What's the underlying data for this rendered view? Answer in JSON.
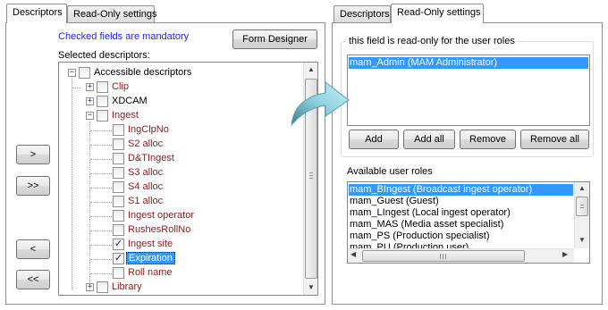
{
  "left": {
    "tabs": [
      "Descriptors",
      "Read-Only settings"
    ],
    "mandatory_note": "Checked fields are mandatory",
    "form_designer_label": "Form Designer",
    "selected_label": "Selected descriptors:",
    "move_buttons": [
      ">",
      ">>",
      "<",
      "<<"
    ],
    "tree": {
      "root": "Accessible descriptors",
      "items": [
        {
          "label": "Clip",
          "checked": false,
          "expander": "+"
        },
        {
          "label": "XDCAM",
          "checked": false,
          "expander": "+"
        },
        {
          "label": "Ingest",
          "checked": false,
          "expander": "-"
        },
        {
          "label": "IngClpNo",
          "checked": false
        },
        {
          "label": "S2 alloc",
          "checked": false
        },
        {
          "label": "D&TIngest",
          "checked": false
        },
        {
          "label": "S3 alloc",
          "checked": false
        },
        {
          "label": "S4 alloc",
          "checked": false
        },
        {
          "label": "S1 alloc",
          "checked": false
        },
        {
          "label": "Ingest operator",
          "checked": false
        },
        {
          "label": "RushesRollNo",
          "checked": false
        },
        {
          "label": "Ingest site",
          "checked": true
        },
        {
          "label": "Expiration",
          "checked": true,
          "selected": true
        },
        {
          "label": "Roll name",
          "checked": false
        },
        {
          "label": "Library",
          "checked": false,
          "expander": "+"
        }
      ]
    }
  },
  "right": {
    "tabs": [
      "Descriptors",
      "Read-Only settings"
    ],
    "group_label": "this field is read-only for the user roles",
    "readonly_roles": [
      "mam_Admin (MAM Administrator)"
    ],
    "buttons": [
      "Add",
      "Add all",
      "Remove",
      "Remove all"
    ],
    "available_label": "Available user roles",
    "available_roles": [
      "mam_BIngest (Broadcast ingest operator)",
      "mam_Guest (Guest)",
      "mam_LIngest (Local ingest operator)",
      "mam_MAS (Media asset specialist)",
      "mam_PS (Production specialist)",
      "mam_PU (Production user)"
    ]
  },
  "colors": {
    "accent": "#3399ff",
    "mandatory_text": "#1a1aff",
    "tree_child_text": "#8b1a1a"
  }
}
